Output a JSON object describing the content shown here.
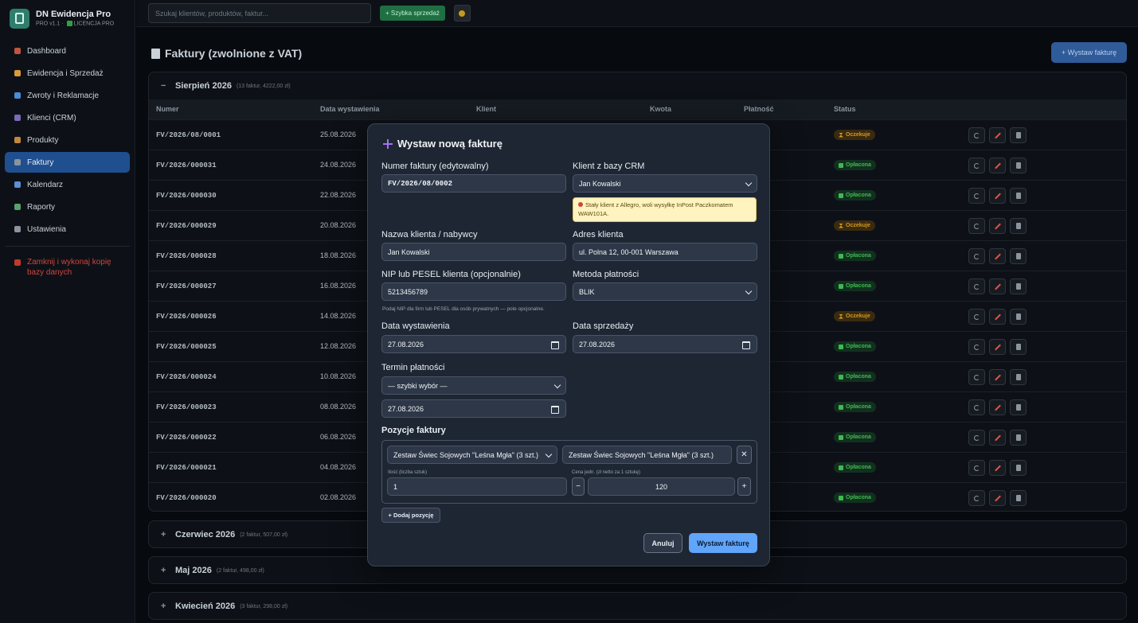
{
  "app": {
    "title": "DN Ewidencja Pro",
    "version": "PRO v1.1",
    "license": "LICENCJA PRO"
  },
  "sidebar": {
    "items": [
      {
        "label": "Dashboard",
        "icon": "home-icon",
        "color": "#c0553f"
      },
      {
        "label": "Ewidencja i Sprzedaż",
        "icon": "box-icon",
        "color": "#d99a3a"
      },
      {
        "label": "Zwroty i Reklamacje",
        "icon": "return-icon",
        "color": "#4c8bd6"
      },
      {
        "label": "Klienci (CRM)",
        "icon": "users-icon",
        "color": "#7a6ab8"
      },
      {
        "label": "Produkty",
        "icon": "product-icon",
        "color": "#c28840"
      },
      {
        "label": "Faktury",
        "icon": "invoice-icon",
        "color": "#8b949e",
        "active": true
      },
      {
        "label": "Kalendarz",
        "icon": "calendar-icon",
        "color": "#5c8fd6"
      },
      {
        "label": "Raporty",
        "icon": "chart-icon",
        "color": "#5aa26b"
      },
      {
        "label": "Ustawienia",
        "icon": "gear-icon",
        "color": "#8b949e"
      }
    ],
    "danger": "Zamknij i wykonaj kopię bazy danych"
  },
  "topbar": {
    "search_placeholder": "Szukaj klientów, produktów, faktur...",
    "quick_sale": "+ Szybka sprzedaż"
  },
  "page": {
    "title": "Faktury (zwolnione z VAT)",
    "issue_button": "+ Wystaw fakturę"
  },
  "groups": [
    {
      "sign": "−",
      "name": "Sierpień 2026",
      "meta": "(13 faktur, 4222,00 zł)"
    },
    {
      "sign": "+",
      "name": "Czerwiec 2026",
      "meta": "(2 faktur, 507,00 zł)"
    },
    {
      "sign": "+",
      "name": "Maj 2026",
      "meta": "(2 faktur, 498,00 zł)"
    },
    {
      "sign": "+",
      "name": "Kwiecień 2026",
      "meta": "(3 faktur, 298,00 zł)"
    }
  ],
  "table": {
    "headers": [
      "Numer",
      "Data wystawienia",
      "Klient",
      "Kwota",
      "Płatność",
      "Status"
    ],
    "rows": [
      {
        "num": "FV/2026/08/0001",
        "date": "25.08.2026",
        "status": "Oczekuje",
        "paid": false
      },
      {
        "num": "FV/2026/000031",
        "date": "24.08.2026",
        "status": "Opłacona",
        "paid": true
      },
      {
        "num": "FV/2026/000030",
        "date": "22.08.2026",
        "status": "Opłacona",
        "paid": true
      },
      {
        "num": "FV/2026/000029",
        "date": "20.08.2026",
        "status": "Oczekuje",
        "paid": false
      },
      {
        "num": "FV/2026/000028",
        "date": "18.08.2026",
        "status": "Opłacona",
        "paid": true
      },
      {
        "num": "FV/2026/000027",
        "date": "16.08.2026",
        "status": "Opłacona",
        "paid": true
      },
      {
        "num": "FV/2026/000026",
        "date": "14.08.2026",
        "status": "Oczekuje",
        "paid": false
      },
      {
        "num": "FV/2026/000025",
        "date": "12.08.2026",
        "status": "Opłacona",
        "paid": true
      },
      {
        "num": "FV/2026/000024",
        "date": "10.08.2026",
        "status": "Opłacona",
        "paid": true
      },
      {
        "num": "FV/2026/000023",
        "date": "08.08.2026",
        "status": "Opłacona",
        "paid": true
      },
      {
        "num": "FV/2026/000022",
        "date": "06.08.2026",
        "status": "Opłacona",
        "paid": true
      },
      {
        "num": "FV/2026/000021",
        "date": "04.08.2026",
        "status": "Opłacona",
        "paid": true
      },
      {
        "num": "FV/2026/000020",
        "date": "02.08.2026",
        "status": "Opłacona",
        "paid": true
      }
    ]
  },
  "modal": {
    "title": "Wystaw nową fakturę",
    "invoice_number_label": "Numer faktury (edytowalny)",
    "invoice_number": "FV/2026/08/0002",
    "crm_label": "Klient z bazy CRM",
    "crm_value": "Jan Kowalski",
    "note": "Stały klient z Allegro, woli wysyłkę InPost Paczkomatem WAW101A.",
    "client_name_label": "Nazwa klienta / nabywcy",
    "client_name": "Jan Kowalski",
    "client_address_label": "Adres klienta",
    "client_address": "ul. Polna 12, 00-001 Warszawa",
    "nip_label": "NIP lub PESEL klienta (opcjonalnie)",
    "nip": "5213456789",
    "nip_hint": "Podaj NIP dla firm lub PESEL dla osób prywatnych — pole opcjonalne.",
    "payment_label": "Metoda płatności",
    "payment": "BLIK",
    "issue_date_label": "Data wystawienia",
    "issue_date": "27.08.2026",
    "sale_date_label": "Data sprzedaży",
    "sale_date": "27.08.2026",
    "due_label": "Termin płatności",
    "due_quick": "— szybki wybór —",
    "due_date": "27.08.2026",
    "items_label": "Pozycje faktury",
    "item_select": "Zestaw Świec Sojowych \"Leśna Mgła\" (3 szt.)",
    "item_name": "Zestaw Świec Sojowych \"Leśna Mgła\" (3 szt.)",
    "qty_label": "Ilość (liczba sztuk)",
    "qty": "1",
    "price_label": "Cena jedn. (zł netto za 1 sztukę)",
    "price": "120",
    "add_item": "+ Dodaj pozycję",
    "cancel": "Anuluj",
    "submit": "Wystaw fakturę"
  }
}
